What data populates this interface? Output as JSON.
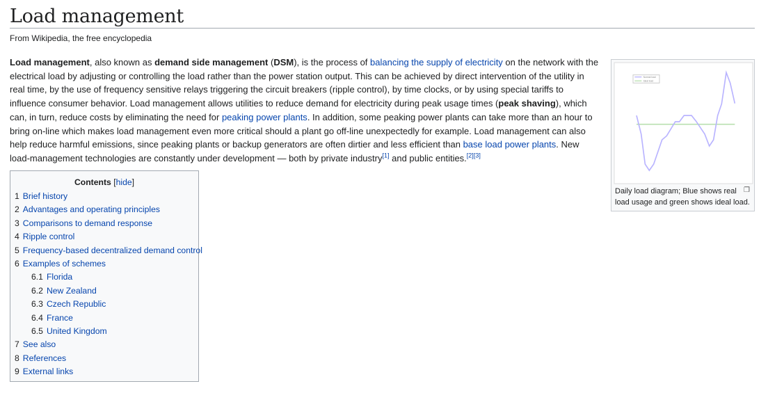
{
  "title": "Load management",
  "tagline": "From Wikipedia, the free encyclopedia",
  "intro": [
    {
      "t": "b",
      "v": "Load management"
    },
    {
      "t": "x",
      "v": ", also known as "
    },
    {
      "t": "b",
      "v": "demand side management"
    },
    {
      "t": "x",
      "v": " ("
    },
    {
      "t": "b",
      "v": "DSM"
    },
    {
      "t": "x",
      "v": "), is the process of "
    },
    {
      "t": "a",
      "v": "balancing the supply of electricity"
    },
    {
      "t": "x",
      "v": " on the network with the electrical load by adjusting or controlling the load rather than the power station output. This can be achieved by direct intervention of the utility in real time, by the use of frequency sensitive relays triggering the circuit breakers (ripple control), by time clocks, or by using special tariffs to influence consumer behavior. Load management allows utilities to reduce demand for electricity during peak usage times ("
    },
    {
      "t": "b",
      "v": "peak shaving"
    },
    {
      "t": "x",
      "v": "), which can, in turn, reduce costs by eliminating the need for "
    },
    {
      "t": "a",
      "v": "peaking power plants"
    },
    {
      "t": "x",
      "v": ". In addition, some peaking power plants can take more than an hour to bring on-line which makes load management even more critical should a plant go off-line unexpectedly for example. Load management can also help reduce harmful emissions, since peaking plants or backup generators are often dirtier and less efficient than "
    },
    {
      "t": "a",
      "v": "base load power plants"
    },
    {
      "t": "x",
      "v": ". New load-management technologies are constantly under development — both by private industry"
    },
    {
      "t": "s",
      "v": "[1]"
    },
    {
      "t": "x",
      "v": " and public entities."
    },
    {
      "t": "s",
      "v": "[2]"
    },
    {
      "t": "s",
      "v": "[3]"
    }
  ],
  "toc": {
    "title": "Contents",
    "hide": "hide",
    "items": [
      {
        "n": "1",
        "label": "Brief history"
      },
      {
        "n": "2",
        "label": "Advantages and operating principles"
      },
      {
        "n": "3",
        "label": "Comparisons to demand response"
      },
      {
        "n": "4",
        "label": "Ripple control"
      },
      {
        "n": "5",
        "label": "Frequency-based decentralized demand control"
      },
      {
        "n": "6",
        "label": "Examples of schemes"
      },
      {
        "n": "6.1",
        "label": "Florida",
        "sub": true
      },
      {
        "n": "6.2",
        "label": "New Zealand",
        "sub": true
      },
      {
        "n": "6.3",
        "label": "Czech Republic",
        "sub": true
      },
      {
        "n": "6.4",
        "label": "France",
        "sub": true
      },
      {
        "n": "6.5",
        "label": "United Kingdom",
        "sub": true
      },
      {
        "n": "7",
        "label": "See also"
      },
      {
        "n": "8",
        "label": "References"
      },
      {
        "n": "9",
        "label": "External links"
      }
    ]
  },
  "thumb": {
    "caption": "Daily load diagram; Blue shows real load usage and green shows ideal load.",
    "legend": [
      "Normal load",
      "Ideal load"
    ],
    "colors": {
      "real": "#b9b4ff",
      "ideal": "#b8e0b0"
    }
  }
}
